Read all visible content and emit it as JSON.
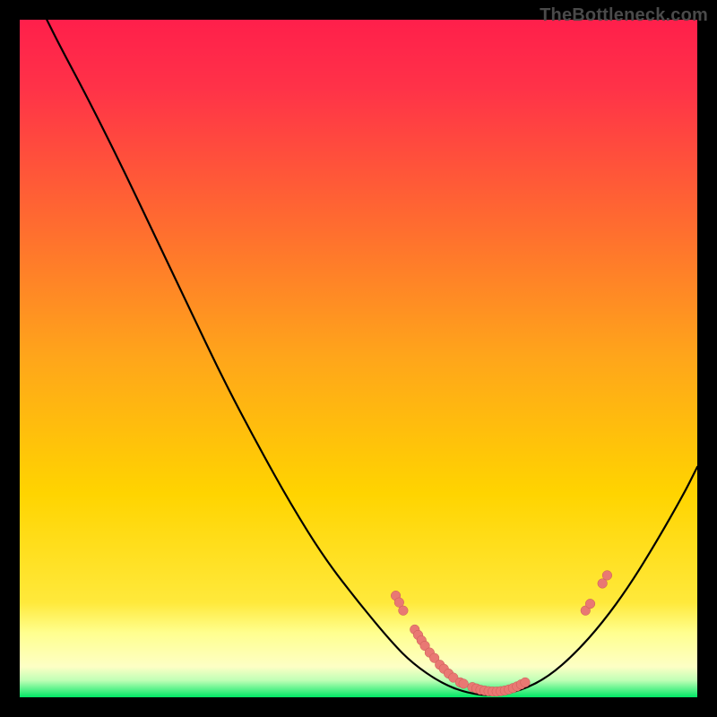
{
  "watermark": "TheBottleneck.com",
  "colors": {
    "gradient_top": "#ff1f4b",
    "gradient_mid": "#ffd400",
    "gradient_band": "#ffff8f",
    "gradient_bottom": "#00e765",
    "curve": "#000000",
    "dot_fill": "#e97873",
    "dot_stroke": "#c85a55"
  },
  "chart_data": {
    "type": "line",
    "title": "",
    "xlabel": "",
    "ylabel": "",
    "xlim": [
      0,
      100
    ],
    "ylim": [
      0,
      100
    ],
    "curve": [
      {
        "x": 4.0,
        "y": 100.0
      },
      {
        "x": 6.0,
        "y": 96.0
      },
      {
        "x": 10.0,
        "y": 88.5
      },
      {
        "x": 15.0,
        "y": 78.5
      },
      {
        "x": 20.0,
        "y": 68.0
      },
      {
        "x": 25.0,
        "y": 57.5
      },
      {
        "x": 30.0,
        "y": 47.0
      },
      {
        "x": 35.0,
        "y": 37.5
      },
      {
        "x": 40.0,
        "y": 28.5
      },
      {
        "x": 45.0,
        "y": 20.5
      },
      {
        "x": 50.0,
        "y": 14.0
      },
      {
        "x": 55.0,
        "y": 8.0
      },
      {
        "x": 58.0,
        "y": 5.0
      },
      {
        "x": 62.0,
        "y": 2.2
      },
      {
        "x": 66.0,
        "y": 0.6
      },
      {
        "x": 70.0,
        "y": 0.2
      },
      {
        "x": 74.0,
        "y": 1.0
      },
      {
        "x": 78.0,
        "y": 3.0
      },
      {
        "x": 82.0,
        "y": 6.5
      },
      {
        "x": 86.0,
        "y": 11.0
      },
      {
        "x": 90.0,
        "y": 16.5
      },
      {
        "x": 94.0,
        "y": 23.0
      },
      {
        "x": 98.0,
        "y": 30.0
      },
      {
        "x": 100.0,
        "y": 34.0
      }
    ],
    "markers": [
      {
        "x": 55.5,
        "y": 15.0
      },
      {
        "x": 56.0,
        "y": 14.0
      },
      {
        "x": 56.6,
        "y": 12.8
      },
      {
        "x": 58.3,
        "y": 10.0
      },
      {
        "x": 58.8,
        "y": 9.2
      },
      {
        "x": 59.3,
        "y": 8.4
      },
      {
        "x": 59.8,
        "y": 7.6
      },
      {
        "x": 60.5,
        "y": 6.6
      },
      {
        "x": 61.2,
        "y": 5.8
      },
      {
        "x": 62.0,
        "y": 4.8
      },
      {
        "x": 62.6,
        "y": 4.2
      },
      {
        "x": 63.3,
        "y": 3.5
      },
      {
        "x": 64.0,
        "y": 2.9
      },
      {
        "x": 65.0,
        "y": 2.2
      },
      {
        "x": 65.5,
        "y": 2.0
      },
      {
        "x": 66.8,
        "y": 1.5
      },
      {
        "x": 67.4,
        "y": 1.3
      },
      {
        "x": 68.0,
        "y": 1.1
      },
      {
        "x": 68.6,
        "y": 1.0
      },
      {
        "x": 69.2,
        "y": 0.9
      },
      {
        "x": 69.8,
        "y": 0.85
      },
      {
        "x": 70.4,
        "y": 0.85
      },
      {
        "x": 71.0,
        "y": 0.9
      },
      {
        "x": 71.6,
        "y": 1.0
      },
      {
        "x": 72.2,
        "y": 1.15
      },
      {
        "x": 72.8,
        "y": 1.35
      },
      {
        "x": 73.4,
        "y": 1.6
      },
      {
        "x": 74.0,
        "y": 1.9
      },
      {
        "x": 74.6,
        "y": 2.2
      },
      {
        "x": 83.5,
        "y": 12.8
      },
      {
        "x": 84.2,
        "y": 13.8
      },
      {
        "x": 86.0,
        "y": 16.8
      },
      {
        "x": 86.7,
        "y": 18.0
      }
    ]
  }
}
